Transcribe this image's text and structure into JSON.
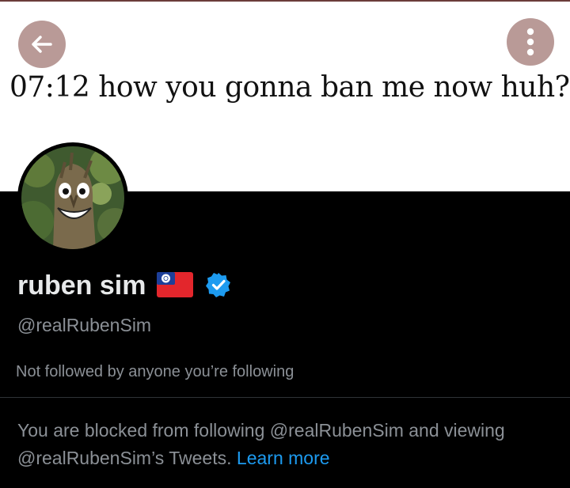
{
  "banner": {
    "text": "07:12 how you gonna ban me now huh?",
    "color": "#ffffff"
  },
  "header": {
    "back_icon": "arrow-left-icon",
    "more_icon": "more-vertical-icon",
    "button_color": "#b99a97"
  },
  "profile": {
    "display_name": "ruben sim",
    "flag_icon": "taiwan-flag-icon",
    "verified_icon": "verified-badge-icon",
    "handle": "@realRubenSim",
    "followed_note": "Not followed by anyone you’re following"
  },
  "blocked_notice": {
    "text": "You are blocked from following @realRubenSim and viewing @realRubenSim’s Tweets. ",
    "link_text": "Learn more",
    "link_color": "#1d9bf0"
  }
}
